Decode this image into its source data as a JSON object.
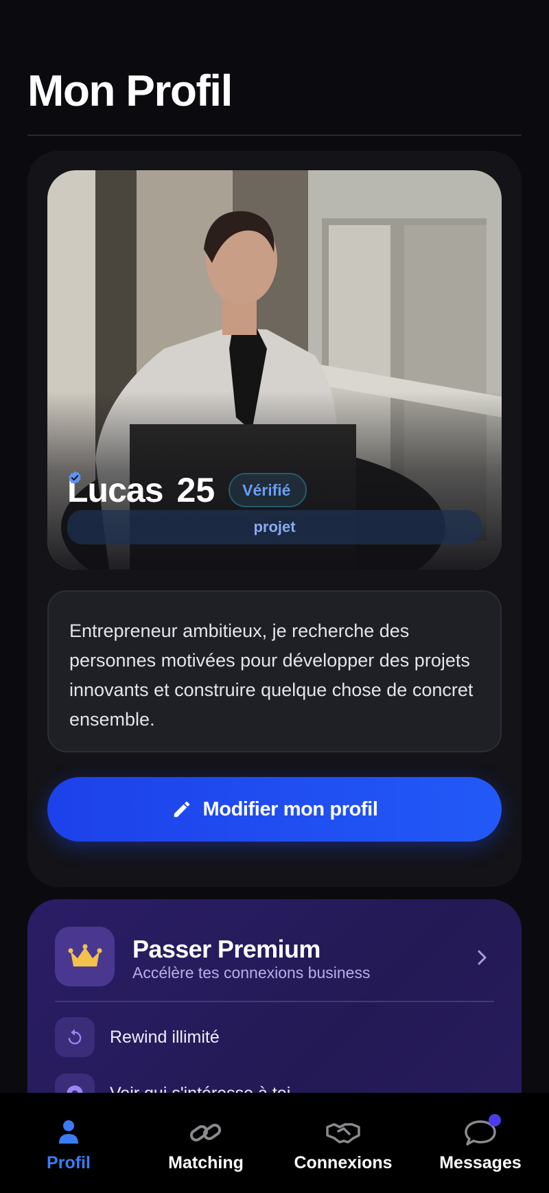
{
  "header": {
    "title": "Mon Profil"
  },
  "profile": {
    "name": "Lucas",
    "age": "25",
    "verified_label": "Vérifié",
    "tag": "projet",
    "bio": "Entrepreneur ambitieux, je recherche des personnes motivées pour développer des projets innovants et construire quelque chose de concret ensemble.",
    "edit_button_label": "Modifier mon profil"
  },
  "premium": {
    "title": "Passer Premium",
    "subtitle": "Accélère tes connexions business",
    "features": [
      {
        "label": "Rewind illimité",
        "icon": "rewind-icon"
      },
      {
        "label": "Voir qui s'intéresse à toi",
        "icon": "eye-icon"
      }
    ]
  },
  "bottom_nav": {
    "items": [
      {
        "label": "Profil",
        "icon": "person-icon",
        "active": true
      },
      {
        "label": "Matching",
        "icon": "link-icon",
        "active": false
      },
      {
        "label": "Connexions",
        "icon": "handshake-icon",
        "active": false
      },
      {
        "label": "Messages",
        "icon": "chat-bubble-icon",
        "active": false,
        "badge": true
      }
    ]
  },
  "colors": {
    "background": "#0b0b0f",
    "accent_blue": "#2259f7",
    "active_nav": "#3b7cf6",
    "premium_purple": "#2b1d66",
    "crown_gold": "#f2c14e"
  }
}
